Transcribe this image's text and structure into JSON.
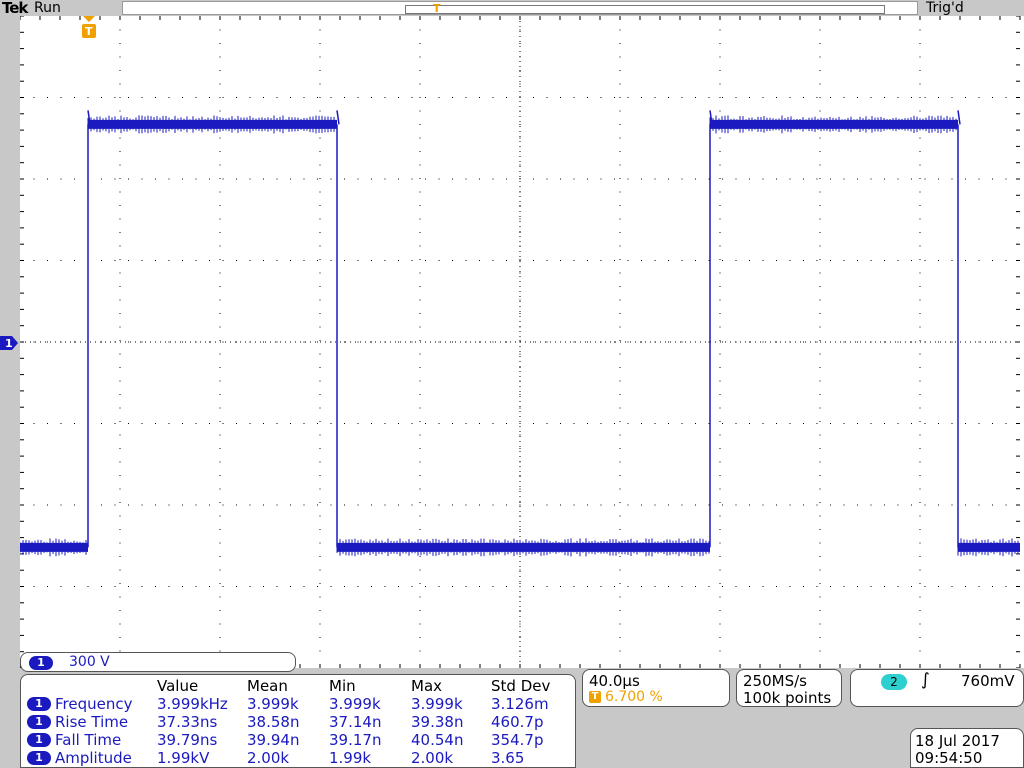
{
  "header": {
    "brand": "Tek",
    "run_state": "Run",
    "trigger_state": "Trig'd"
  },
  "markers": {
    "channel_marker": "1",
    "trigger_marker": "T"
  },
  "channel1": {
    "badge": "1",
    "scale": "300 V",
    "color": "#1a1ac0"
  },
  "measurements": {
    "headers": [
      "Value",
      "Mean",
      "Min",
      "Max",
      "Std Dev"
    ],
    "rows": [
      {
        "badge": "1",
        "name": "Frequency",
        "value": "3.999kHz",
        "mean": "3.999k",
        "min": "3.999k",
        "max": "3.999k",
        "std": "3.126m"
      },
      {
        "badge": "1",
        "name": "Rise Time",
        "value": "37.33ns",
        "mean": "38.58n",
        "min": "37.14n",
        "max": "39.38n",
        "std": "460.7p"
      },
      {
        "badge": "1",
        "name": "Fall Time",
        "value": "39.79ns",
        "mean": "39.94n",
        "min": "39.17n",
        "max": "40.54n",
        "std": "354.7p"
      },
      {
        "badge": "1",
        "name": "Amplitude",
        "value": "1.99kV",
        "mean": "2.00k",
        "min": "1.99k",
        "max": "2.00k",
        "std": "3.65"
      }
    ]
  },
  "timebase": {
    "scale": "40.0µs",
    "trigger_icon": "T",
    "trigger_position": "6.700 %"
  },
  "acquisition": {
    "sample_rate": "250MS/s",
    "record_length": "100k points"
  },
  "trigger": {
    "source_badge": "2",
    "slope_icon": "rising-edge-icon",
    "slope_glyph": "∫",
    "level": "760mV"
  },
  "datetime": {
    "date": "18 Jul  2017",
    "time": "09:54:50"
  },
  "colors": {
    "trace": "#1a1ac0",
    "trigger": "#f0a000",
    "trigger_channel": "#2ecfcf",
    "grid": "#000000"
  },
  "chart_data": {
    "type": "line",
    "title": "",
    "xlabel": "",
    "ylabel": "",
    "x_unit_per_div": "40.0µs",
    "y_unit_per_div": "300 V",
    "grid": true,
    "divisions": {
      "x": 10,
      "y": 8
    },
    "xlim_div": [
      0,
      10
    ],
    "ylim_div": [
      -4,
      4
    ],
    "series": [
      {
        "x_div": [
          0,
          0.68,
          0.68,
          3.17,
          3.17,
          6.9,
          6.9,
          9.38,
          9.38,
          10
        ],
        "y_div": [
          -2.52,
          -2.52,
          2.67,
          2.67,
          -2.52,
          -2.52,
          2.67,
          2.67,
          -2.52,
          -2.52
        ]
      }
    ]
  }
}
